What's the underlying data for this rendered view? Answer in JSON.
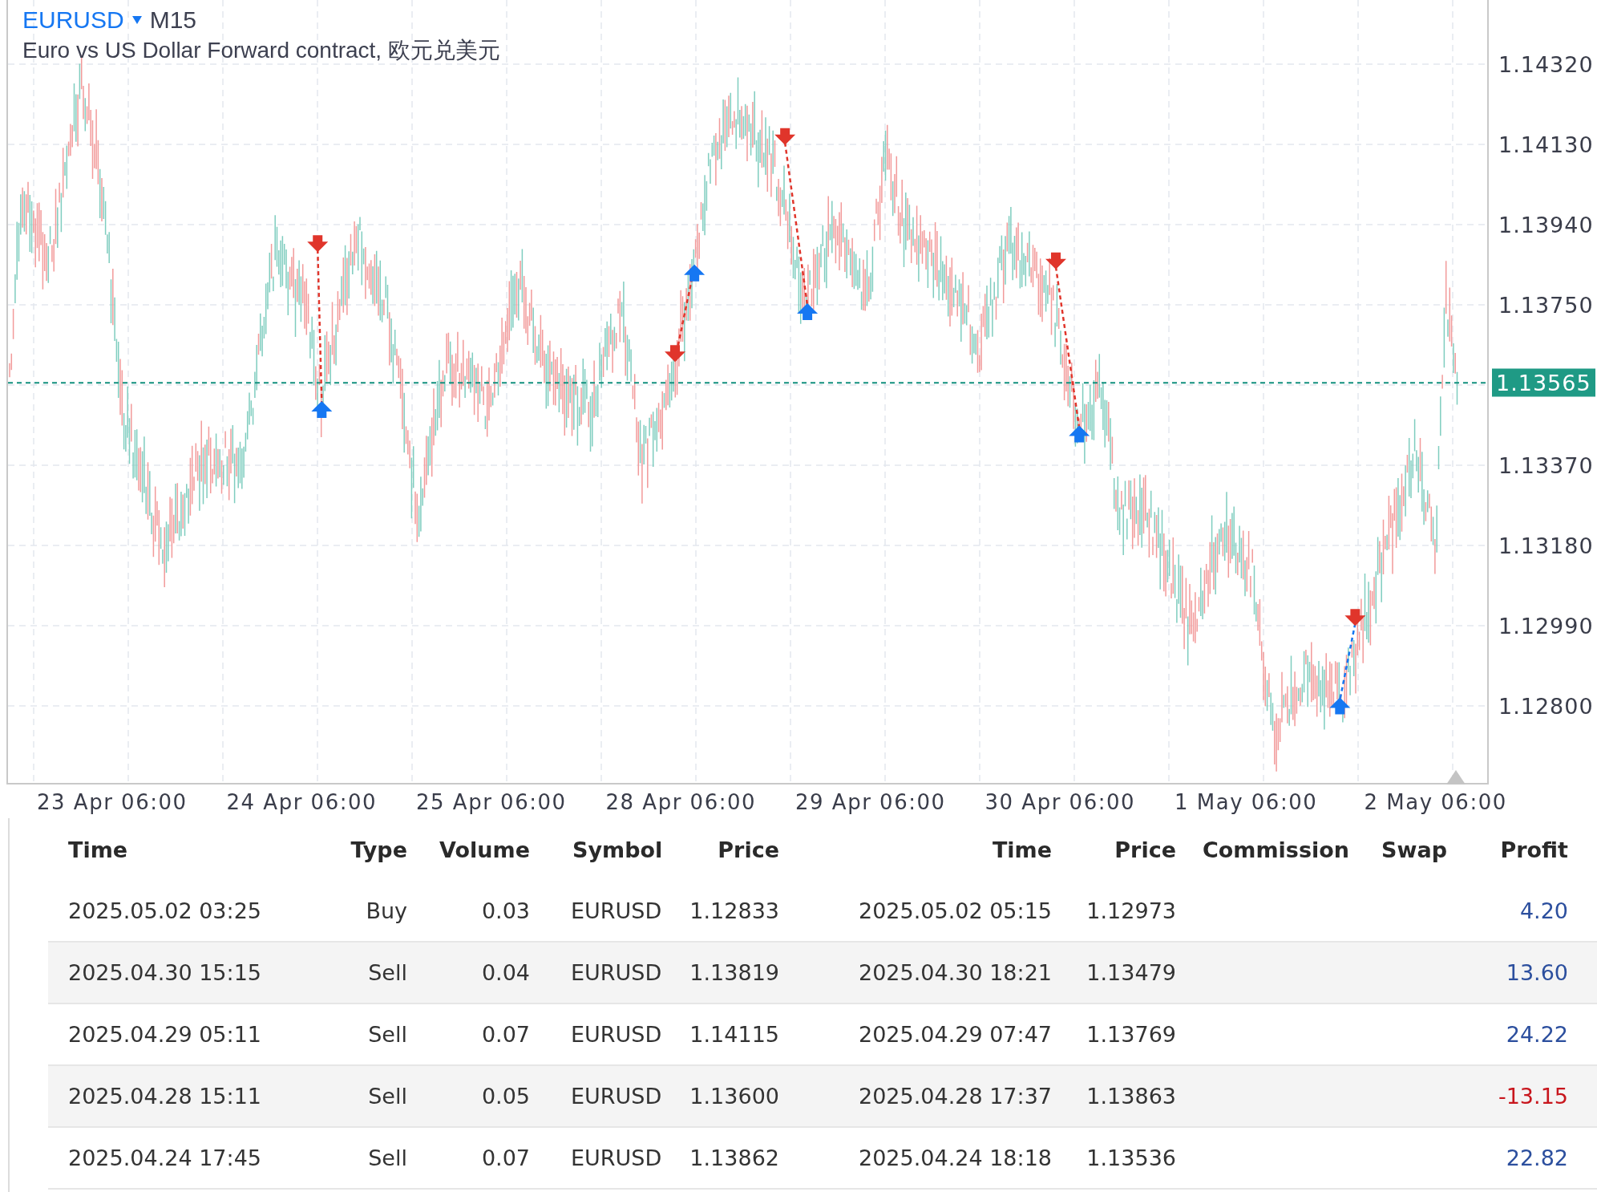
{
  "symbol": {
    "name": "EURUSD",
    "timeframe": "M15",
    "description": "Euro vs US Dollar Forward contract, 欧元兑美元"
  },
  "chart": {
    "price_ticks": [
      "1.14320",
      "1.14130",
      "1.13940",
      "1.13750",
      "1.13370",
      "1.13180",
      "1.12990",
      "1.12800"
    ],
    "current_price": "1.13565",
    "time_labels": [
      "23 Apr 06:00",
      "24 Apr 06:00",
      "25 Apr 06:00",
      "28 Apr 06:00",
      "29 Apr 06:00",
      "30 Apr 06:00",
      "1 May 06:00",
      "2 May 06:00"
    ]
  },
  "table": {
    "columns": [
      "Time",
      "Type",
      "Volume",
      "Symbol",
      "Price",
      "Time",
      "Price",
      "Commission",
      "Swap",
      "Profit"
    ],
    "rows": [
      {
        "cells": [
          "2025.05.02 03:25",
          "Buy",
          "0.03",
          "EURUSD",
          "1.12833",
          "2025.05.02 05:15",
          "1.12973",
          "",
          "",
          "4.20"
        ],
        "color": "#2c4f9e"
      },
      {
        "cells": [
          "2025.04.30 15:15",
          "Sell",
          "0.04",
          "EURUSD",
          "1.13819",
          "2025.04.30 18:21",
          "1.13479",
          "",
          "",
          "13.60"
        ],
        "color": "#2c4f9e"
      },
      {
        "cells": [
          "2025.04.29 05:11",
          "Sell",
          "0.07",
          "EURUSD",
          "1.14115",
          "2025.04.29 07:47",
          "1.13769",
          "",
          "",
          "24.22"
        ],
        "color": "#2c4f9e"
      },
      {
        "cells": [
          "2025.04.28 15:11",
          "Sell",
          "0.05",
          "EURUSD",
          "1.13600",
          "2025.04.28 17:37",
          "1.13863",
          "",
          "",
          "-13.15"
        ],
        "color": "#c8161d"
      },
      {
        "cells": [
          "2025.04.24 17:45",
          "Sell",
          "0.07",
          "EURUSD",
          "1.13862",
          "2025.04.24 18:18",
          "1.13536",
          "",
          "",
          "22.82"
        ],
        "color": "#2c4f9e"
      }
    ]
  }
}
